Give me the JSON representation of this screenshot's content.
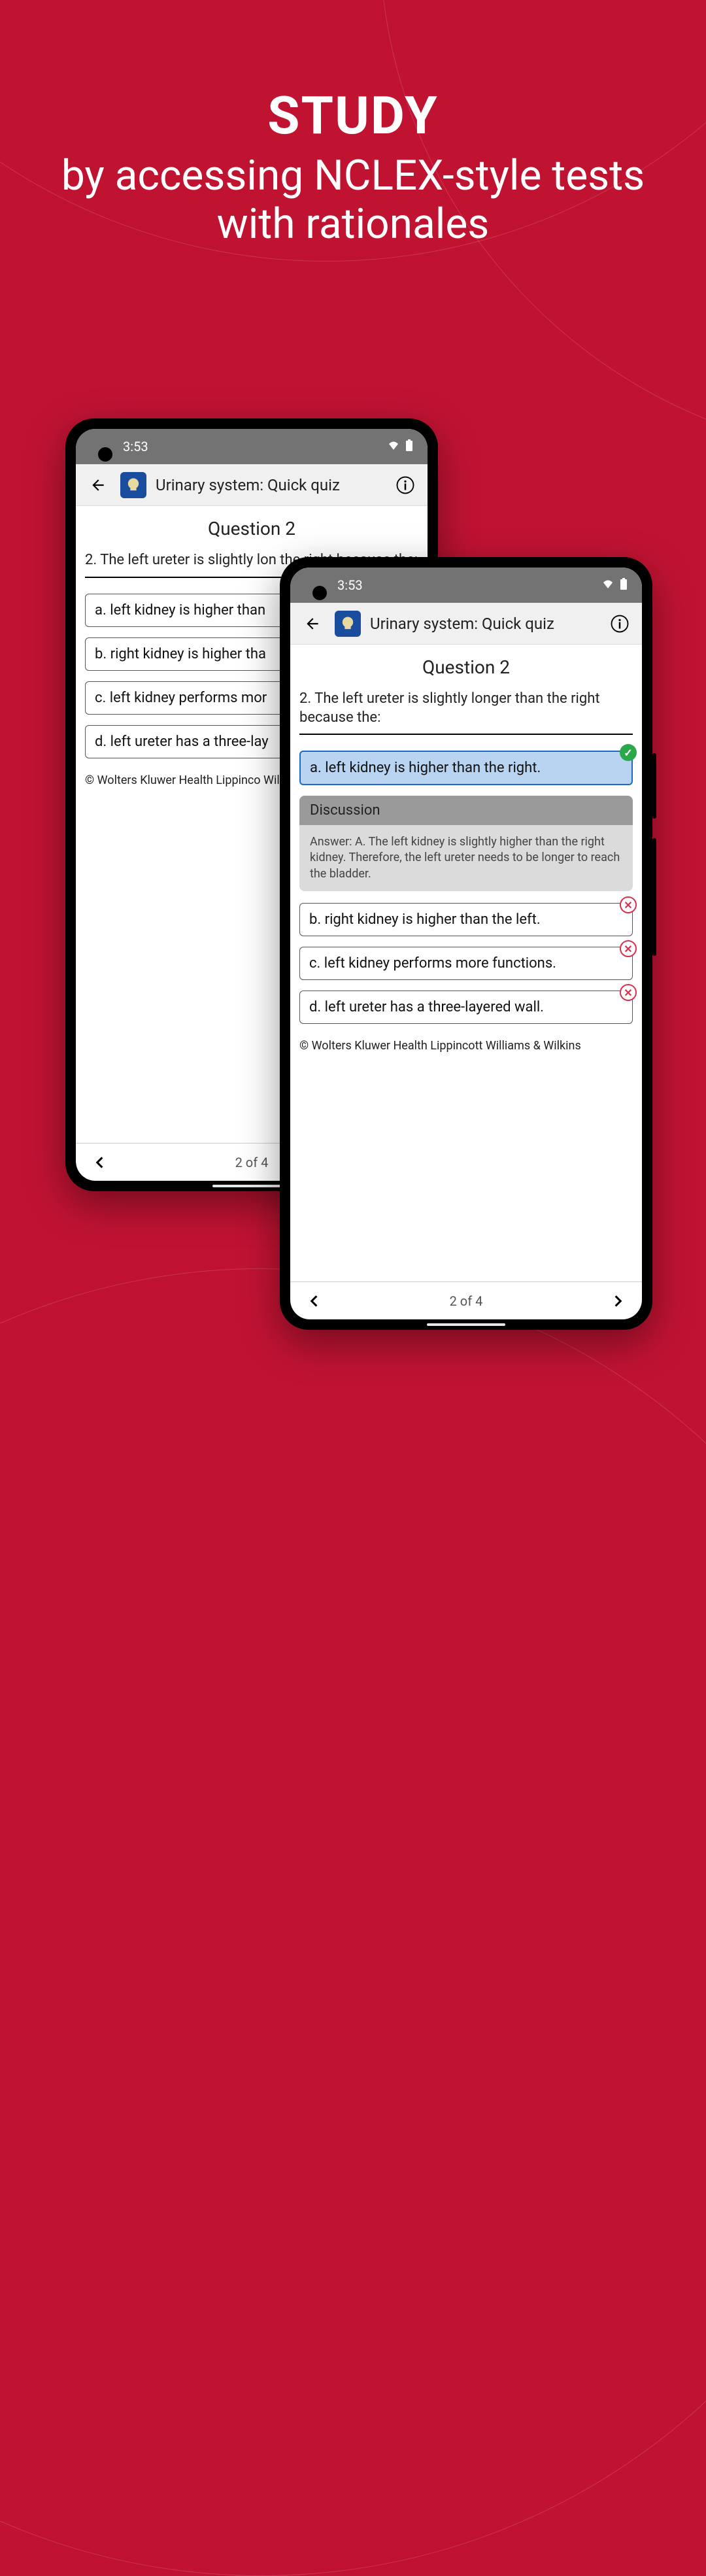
{
  "headline": {
    "title": "STUDY",
    "subtitle": "by accessing NCLEX-style tests with rationales"
  },
  "status": {
    "time": "3:53"
  },
  "appbar": {
    "title": "Urinary system: Quick quiz"
  },
  "question": {
    "title": "Question 2",
    "text_full": "2. The left ureter is slightly longer than the right because the:",
    "text_clipped": "2. The left ureter is slightly lon          the right because the:"
  },
  "answers_left": {
    "a": "a. left kidney is higher than",
    "b": "b. right kidney is higher tha",
    "c": "c. left kidney performs mor",
    "d": "d. left ureter has a three-lay"
  },
  "answers_right": {
    "a": "a. left kidney is higher than the right.",
    "b": "b. right kidney is higher than the left.",
    "c": "c. left kidney performs more functions.",
    "d": "d. left ureter has a three-layered wall."
  },
  "discussion": {
    "title": "Discussion",
    "body": "Answer: A. The left kidney is slightly higher than the right kidney. Therefore, the left ureter needs to be longer to reach the bladder."
  },
  "copyright": "© Wolters Kluwer Health Lippincott Williams & Wilkins",
  "copyright_clipped": "© Wolters Kluwer Health Lippinco         Wilkins",
  "nav": {
    "count": "2 of 4"
  }
}
